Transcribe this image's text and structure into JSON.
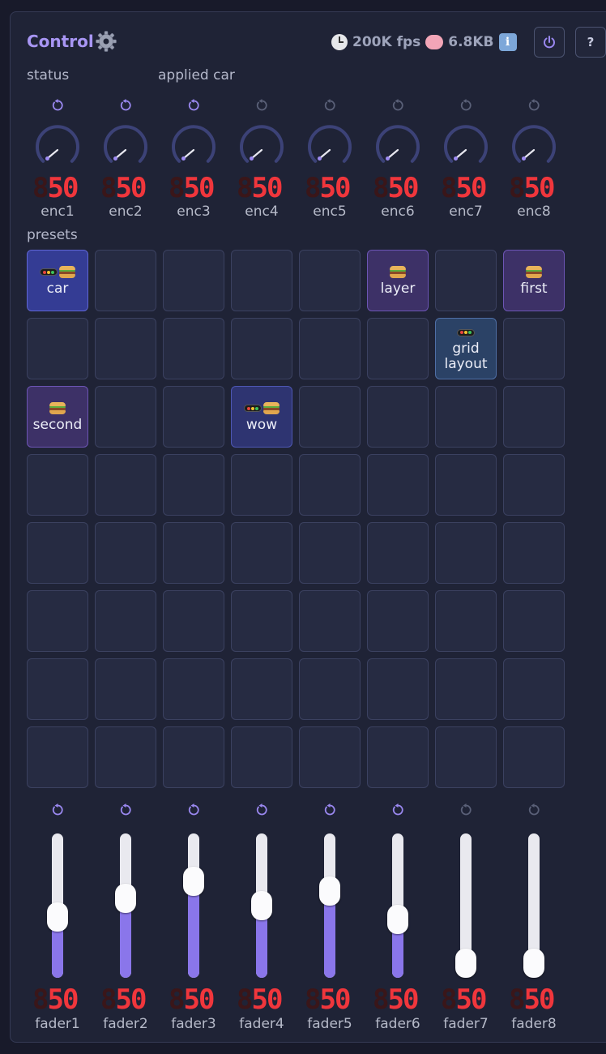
{
  "header": {
    "title": "Control",
    "fps": "200K fps",
    "memory": "6.8KB",
    "help_label": "?",
    "icons": [
      "gear-icon",
      "clock-icon",
      "brain-icon",
      "info-icon",
      "power-icon"
    ]
  },
  "labels": {
    "status": "status",
    "applied": "applied car",
    "presets": "presets"
  },
  "encoders": [
    {
      "name": "enc1",
      "value": "50",
      "ghost": "8",
      "active": true
    },
    {
      "name": "enc2",
      "value": "50",
      "ghost": "8",
      "active": true
    },
    {
      "name": "enc3",
      "value": "50",
      "ghost": "8",
      "active": true
    },
    {
      "name": "enc4",
      "value": "50",
      "ghost": "8",
      "active": false
    },
    {
      "name": "enc5",
      "value": "50",
      "ghost": "8",
      "active": false
    },
    {
      "name": "enc6",
      "value": "50",
      "ghost": "8",
      "active": false
    },
    {
      "name": "enc7",
      "value": "50",
      "ghost": "8",
      "active": false
    },
    {
      "name": "enc8",
      "value": "50",
      "ghost": "8",
      "active": false
    }
  ],
  "presets": [
    {
      "row": 0,
      "col": 0,
      "label": "car",
      "color": "blue",
      "icons": [
        "traffic-light-icon",
        "burger-icon"
      ]
    },
    {
      "row": 0,
      "col": 5,
      "label": "layer",
      "color": "purple",
      "icons": [
        "burger-icon"
      ]
    },
    {
      "row": 0,
      "col": 7,
      "label": "first",
      "color": "purple",
      "icons": [
        "burger-icon"
      ]
    },
    {
      "row": 1,
      "col": 6,
      "label": "grid\nlayout",
      "color": "steel",
      "icons": [
        "traffic-light-icon"
      ]
    },
    {
      "row": 2,
      "col": 0,
      "label": "second",
      "color": "purple",
      "icons": [
        "burger-icon"
      ]
    },
    {
      "row": 2,
      "col": 3,
      "label": "wow",
      "color": "indigo",
      "icons": [
        "traffic-light-icon",
        "burger-icon"
      ]
    }
  ],
  "faders": [
    {
      "name": "fader1",
      "value": "50",
      "ghost": "8",
      "level": 0.4,
      "active": true
    },
    {
      "name": "fader2",
      "value": "50",
      "ghost": "8",
      "level": 0.56,
      "active": true
    },
    {
      "name": "fader3",
      "value": "50",
      "ghost": "8",
      "level": 0.71,
      "active": true
    },
    {
      "name": "fader4",
      "value": "50",
      "ghost": "8",
      "level": 0.5,
      "active": true
    },
    {
      "name": "fader5",
      "value": "50",
      "ghost": "8",
      "level": 0.63,
      "active": true
    },
    {
      "name": "fader6",
      "value": "50",
      "ghost": "8",
      "level": 0.38,
      "active": true
    },
    {
      "name": "fader7",
      "value": "50",
      "ghost": "8",
      "level": 0.0,
      "active": false
    },
    {
      "name": "fader8",
      "value": "50",
      "ghost": "8",
      "level": 0.0,
      "active": false
    }
  ],
  "colors": {
    "accent": "#a896f4",
    "reset_active": "#9a88f0",
    "reset_inactive": "#5a6078",
    "knob_track": "#3c4277",
    "segment": "#f0363c",
    "fader_fill": "#8a76ea"
  }
}
